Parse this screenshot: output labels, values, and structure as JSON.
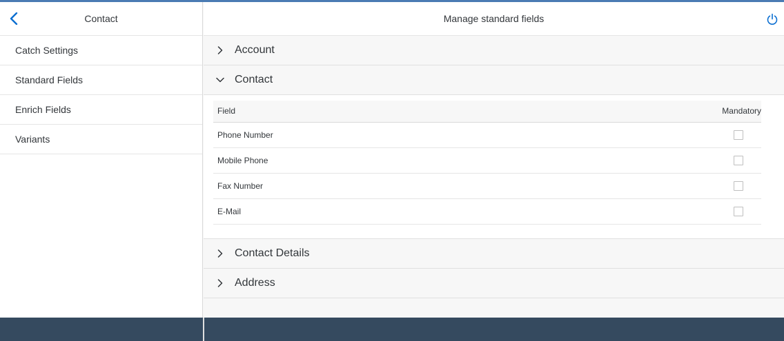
{
  "master": {
    "title": "Contact",
    "items": [
      {
        "label": "Catch Settings"
      },
      {
        "label": "Standard Fields"
      },
      {
        "label": "Enrich Fields"
      },
      {
        "label": "Variants"
      }
    ]
  },
  "detail": {
    "title": "Manage standard fields",
    "panels": [
      {
        "title": "Account",
        "expanded": false
      },
      {
        "title": "Contact",
        "expanded": true
      },
      {
        "title": "Contact Details",
        "expanded": false
      },
      {
        "title": "Address",
        "expanded": false
      }
    ],
    "table": {
      "columns": [
        "Field",
        "Mandatory"
      ],
      "rows": [
        {
          "field": "Phone Number",
          "mandatory": false
        },
        {
          "field": "Mobile Phone",
          "mandatory": false
        },
        {
          "field": "Fax Number",
          "mandatory": false
        },
        {
          "field": "E-Mail",
          "mandatory": false
        }
      ]
    }
  },
  "icons": {
    "back": "chevron-left-icon",
    "power": "power-icon",
    "collapsed": "chevron-right-icon",
    "expanded": "chevron-down-icon"
  },
  "colors": {
    "accent": "#0a6ed1",
    "footer": "#354a5f",
    "topline": "#4a7bb3"
  }
}
